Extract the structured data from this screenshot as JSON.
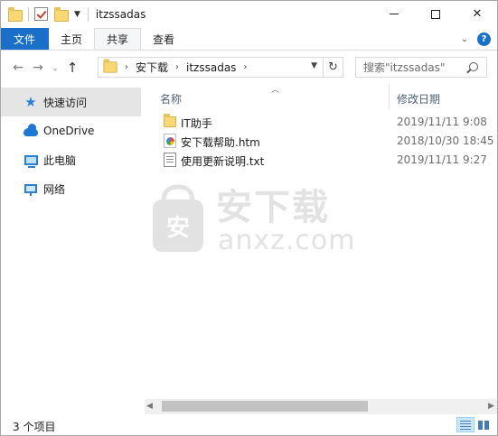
{
  "window": {
    "title": "itzssadas"
  },
  "ribbon": {
    "tabs": [
      {
        "label": "文件"
      },
      {
        "label": "主页"
      },
      {
        "label": "共享"
      },
      {
        "label": "查看"
      }
    ],
    "active_tab": "共享",
    "help_glyph": "?"
  },
  "nav": {
    "back_glyph": "←",
    "forward_glyph": "→",
    "recent_glyph": "⌄",
    "up_glyph": "↑",
    "breadcrumbs": [
      {
        "label": "安下载"
      },
      {
        "label": "itzssadas"
      }
    ],
    "refresh_glyph": "↻",
    "search_placeholder": "搜索\"itzssadas\""
  },
  "sidebar": {
    "items": [
      {
        "label": "快速访问",
        "icon": "quick-access-star-icon"
      },
      {
        "label": "OneDrive",
        "icon": "onedrive-cloud-icon"
      },
      {
        "label": "此电脑",
        "icon": "this-pc-icon"
      },
      {
        "label": "网络",
        "icon": "network-icon"
      }
    ],
    "selected": "快速访问"
  },
  "list": {
    "columns": {
      "name": "名称",
      "modified": "修改日期"
    },
    "rows": [
      {
        "name": "IT助手",
        "modified": "2019/11/11 9:08",
        "type": "folder"
      },
      {
        "name": "安下载帮助.htm",
        "modified": "2018/10/30 18:45",
        "type": "htm"
      },
      {
        "name": "使用更新说明.txt",
        "modified": "2019/11/11 9:27",
        "type": "txt"
      }
    ]
  },
  "watermark": {
    "text": "安下载",
    "domain": "anxz.com",
    "logo_char": "安"
  },
  "status": {
    "item_count": "3 个项目"
  },
  "colors": {
    "accent": "#1a6fc9",
    "folder": "#f8d775",
    "selection": "#e5e5e5"
  }
}
